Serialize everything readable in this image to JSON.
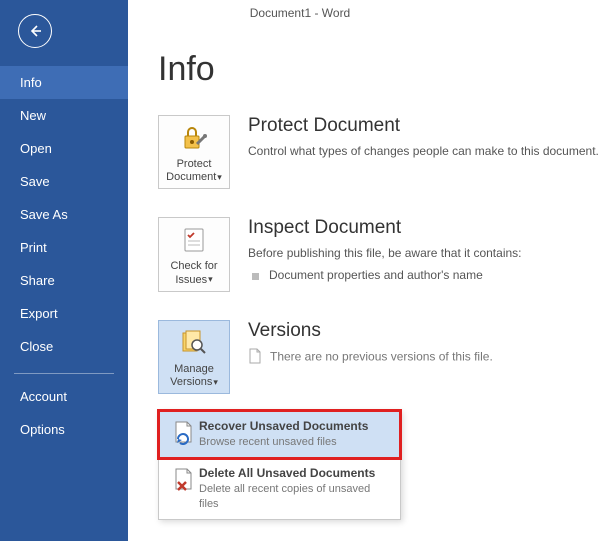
{
  "window_title": "Document1 - Word",
  "sidebar": [
    {
      "label": "Info",
      "active": true
    },
    {
      "label": "New"
    },
    {
      "label": "Open"
    },
    {
      "label": "Save"
    },
    {
      "label": "Save As"
    },
    {
      "label": "Print"
    },
    {
      "label": "Share"
    },
    {
      "label": "Export"
    },
    {
      "label": "Close"
    }
  ],
  "sidebar_lower": [
    {
      "label": "Account"
    },
    {
      "label": "Options"
    }
  ],
  "page_title": "Info",
  "protect": {
    "btn_line1": "Protect",
    "btn_line2": "Document",
    "title": "Protect Document",
    "desc": "Control what types of changes people can make to this document."
  },
  "inspect": {
    "btn_line1": "Check for",
    "btn_line2": "Issues",
    "title": "Inspect Document",
    "desc": "Before publishing this file, be aware that it contains:",
    "bullet": "Document properties and author's name"
  },
  "versions": {
    "btn_line1": "Manage",
    "btn_line2": "Versions",
    "title": "Versions",
    "desc": "There are no previous versions of this file."
  },
  "menu": {
    "recover_title": "Recover Unsaved Documents",
    "recover_desc": "Browse recent unsaved files",
    "delete_title": "Delete All Unsaved Documents",
    "delete_desc": "Delete all recent copies of unsaved files"
  }
}
